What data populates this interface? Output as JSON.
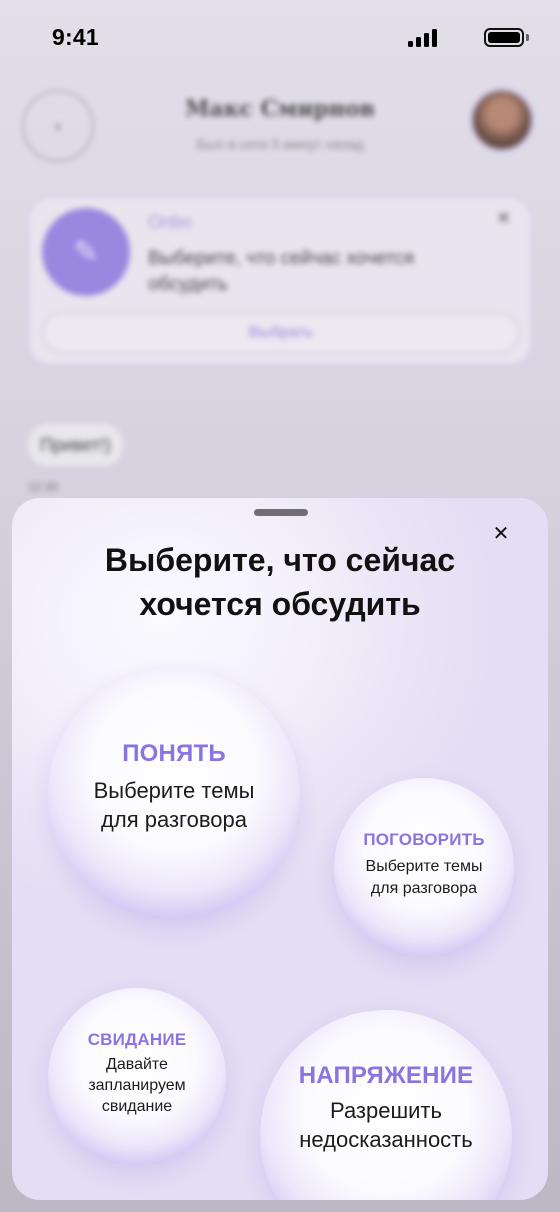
{
  "status_bar": {
    "time": "9:41"
  },
  "background_chat": {
    "back_icon": "chevron-left-icon",
    "title": "Макс Смирнов",
    "subtitle": "Был в сети 5 минут назад",
    "card": {
      "tag": "Onbo",
      "text": "Выберите, что сейчас хочется обсудить",
      "button_label": "Выбрать"
    },
    "message": "Привет!)",
    "message_time": "12:30"
  },
  "sheet": {
    "title": "Выберите, что сейчас хочется обсудить",
    "close_icon": "close-icon",
    "topics": [
      {
        "title": "ПОНЯТЬ",
        "description": "Выберите темы для разговора"
      },
      {
        "title": "ПОГОВОРИТЬ",
        "description": "Выберите темы для разговора"
      },
      {
        "title": "СВИДАНИЕ",
        "description": "Давайте запланируем свидание"
      },
      {
        "title": "НАПРЯЖЕНИЕ",
        "description": "Разрешить недосказанность"
      }
    ]
  },
  "colors": {
    "accent": "#8B74E0",
    "bubble_edge": "#9F8CE6",
    "sheet_background": "#F2EFFA"
  }
}
